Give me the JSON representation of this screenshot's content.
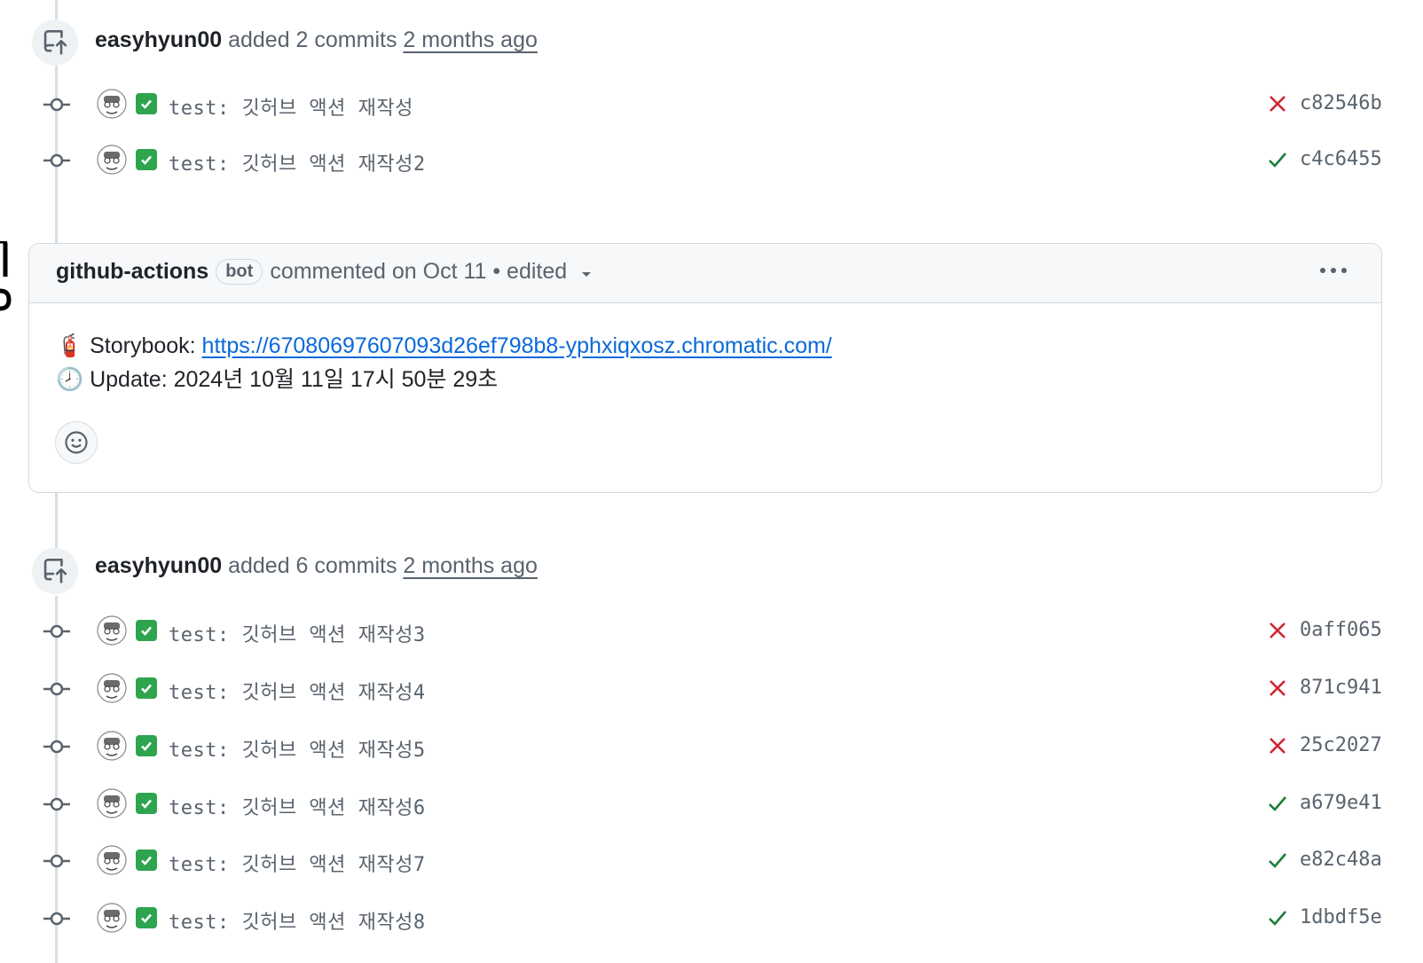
{
  "events": [
    {
      "author": "easyhyun00",
      "action": " added 2 commits ",
      "time": "2 months ago",
      "icon": "repo-push-icon",
      "commits": [
        {
          "message": "test: 깃허브 액션 재작성",
          "status": "failure",
          "sha": "c82546b"
        },
        {
          "message": "test: 깃허브 액션 재작성2",
          "status": "success",
          "sha": "c4c6455"
        }
      ]
    },
    {
      "author": "easyhyun00",
      "action": " added 6 commits ",
      "time": "2 months ago",
      "icon": "repo-push-icon",
      "commits": [
        {
          "message": "test: 깃허브 액션 재작성3",
          "status": "failure",
          "sha": "0aff065"
        },
        {
          "message": "test: 깃허브 액션 재작성4",
          "status": "failure",
          "sha": "871c941"
        },
        {
          "message": "test: 깃허브 액션 재작성5",
          "status": "failure",
          "sha": "25c2027"
        },
        {
          "message": "test: 깃허브 액션 재작성6",
          "status": "success",
          "sha": "a679e41"
        },
        {
          "message": "test: 깃허브 액션 재작성7",
          "status": "success",
          "sha": "e82c48a"
        },
        {
          "message": "test: 깃허브 액션 재작성8",
          "status": "success",
          "sha": "1dbdf5e"
        }
      ]
    }
  ],
  "comment": {
    "author": "github-actions",
    "badge": "bot",
    "meta": "commented on Oct 11 • edited",
    "storybook_label": "Storybook: ",
    "storybook_emoji": "🧯",
    "storybook_url": "https://67080697607093d26ef798b8-yphxiqxosz.chromatic.com/",
    "update_emoji": "🕗",
    "update_text": "Update: 2024년 10월 11일 17시 50분 29초"
  },
  "colors": {
    "failure": "#d1242f",
    "success": "#1a7f37",
    "link": "#0969da",
    "check_bg": "#2ea44f"
  }
}
